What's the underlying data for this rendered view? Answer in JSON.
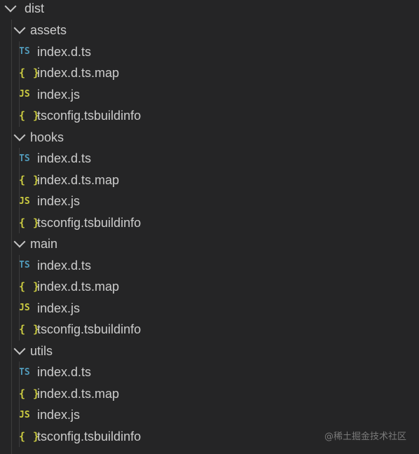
{
  "explorer": {
    "root": {
      "label": "dist",
      "expanded": true
    },
    "folders": [
      {
        "label": "assets",
        "expanded": true,
        "files": [
          {
            "icon": "TS",
            "type": "ts",
            "label": "index.d.ts"
          },
          {
            "icon": "{ }",
            "type": "json",
            "label": "index.d.ts.map"
          },
          {
            "icon": "JS",
            "type": "js",
            "label": "index.js"
          },
          {
            "icon": "{ }",
            "type": "json",
            "label": "tsconfig.tsbuildinfo"
          }
        ]
      },
      {
        "label": "hooks",
        "expanded": true,
        "files": [
          {
            "icon": "TS",
            "type": "ts",
            "label": "index.d.ts"
          },
          {
            "icon": "{ }",
            "type": "json",
            "label": "index.d.ts.map"
          },
          {
            "icon": "JS",
            "type": "js",
            "label": "index.js"
          },
          {
            "icon": "{ }",
            "type": "json",
            "label": "tsconfig.tsbuildinfo"
          }
        ]
      },
      {
        "label": "main",
        "expanded": true,
        "files": [
          {
            "icon": "TS",
            "type": "ts",
            "label": "index.d.ts"
          },
          {
            "icon": "{ }",
            "type": "json",
            "label": "index.d.ts.map"
          },
          {
            "icon": "JS",
            "type": "js",
            "label": "index.js"
          },
          {
            "icon": "{ }",
            "type": "json",
            "label": "tsconfig.tsbuildinfo"
          }
        ]
      },
      {
        "label": "utils",
        "expanded": true,
        "files": [
          {
            "icon": "TS",
            "type": "ts",
            "label": "index.d.ts"
          },
          {
            "icon": "{ }",
            "type": "json",
            "label": "index.d.ts.map"
          },
          {
            "icon": "JS",
            "type": "js",
            "label": "index.js"
          },
          {
            "icon": "{ }",
            "type": "json",
            "label": "tsconfig.tsbuildinfo"
          }
        ]
      }
    ]
  },
  "watermark": "@稀土掘金技术社区",
  "colors": {
    "background": "#252526",
    "text": "#cccccc",
    "ts_icon": "#519aba",
    "js_icon": "#cbcb41",
    "json_icon": "#cbcb41"
  }
}
